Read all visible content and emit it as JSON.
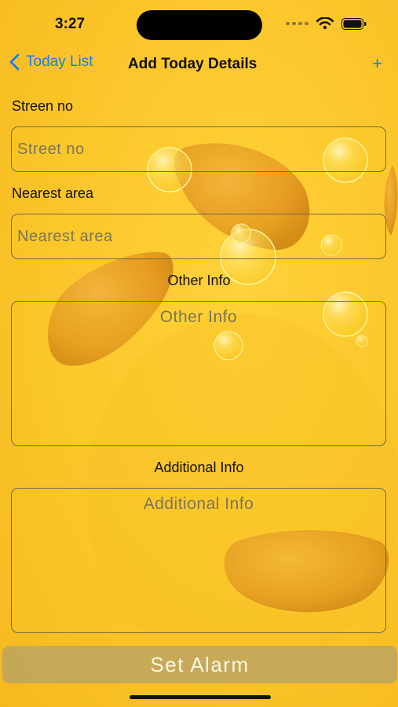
{
  "status": {
    "time": "3:27"
  },
  "nav": {
    "back_label": "Today List",
    "title": "Add Today Details",
    "add_label": "+"
  },
  "form": {
    "street_label": "Streen no",
    "street_placeholder": "Street no",
    "area_label": "Nearest area",
    "area_placeholder": "Nearest area",
    "other_label": "Other Info",
    "other_placeholder": "Other Info",
    "additional_label": "Additional Info",
    "additional_placeholder": "Additional Info"
  },
  "actions": {
    "set_alarm_label": "Set Alarm"
  },
  "colors": {
    "accent": "#1e7cf0",
    "background": "#fbc52a",
    "mango": "#e8a124"
  }
}
